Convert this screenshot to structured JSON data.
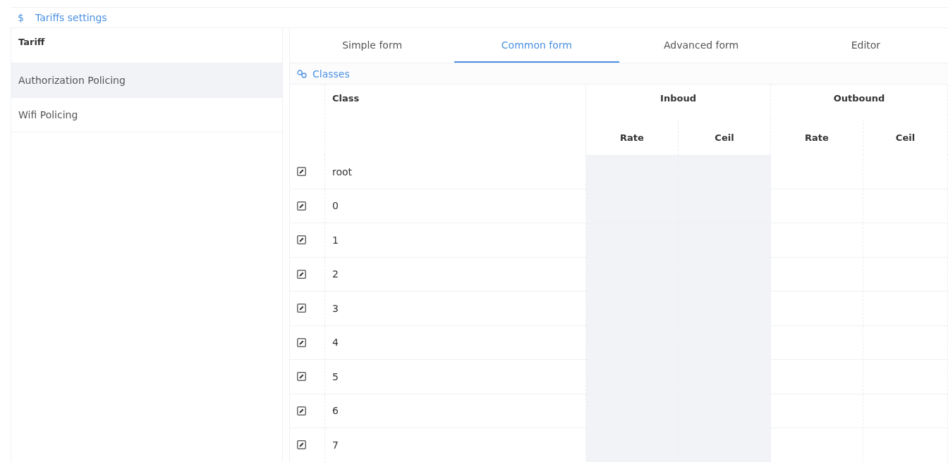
{
  "page_title": {
    "icon": "$",
    "text": "Tariffs settings"
  },
  "tariff_list": {
    "header": "Tariff",
    "items": [
      {
        "label": "Authorization Policing",
        "selected": true
      },
      {
        "label": "Wifi Policing",
        "selected": false
      }
    ]
  },
  "tabs": [
    {
      "label": "Simple form",
      "selected": false
    },
    {
      "label": "Common form",
      "selected": true
    },
    {
      "label": "Advanced form",
      "selected": false
    },
    {
      "label": "Editor",
      "selected": false
    }
  ],
  "section_title": "Classes",
  "table": {
    "class_header": "Class",
    "groups": [
      {
        "label": "Inboud",
        "columns": [
          "Rate",
          "Ceil"
        ]
      },
      {
        "label": "Outbound",
        "columns": [
          "Rate",
          "Ceil"
        ]
      }
    ],
    "rows": [
      {
        "class": "root"
      },
      {
        "class": "0"
      },
      {
        "class": "1"
      },
      {
        "class": "2"
      },
      {
        "class": "3"
      },
      {
        "class": "4"
      },
      {
        "class": "5"
      },
      {
        "class": "6"
      },
      {
        "class": "7"
      }
    ]
  }
}
